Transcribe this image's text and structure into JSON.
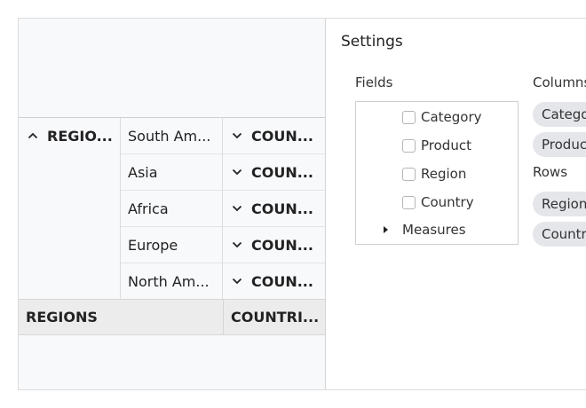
{
  "grid": {
    "row_header": "REGIO...",
    "rows": [
      {
        "region": "South Am...",
        "countries": "COUN..."
      },
      {
        "region": "Asia",
        "countries": "COUN..."
      },
      {
        "region": "Africa",
        "countries": "COUN..."
      },
      {
        "region": "Europe",
        "countries": "COUN..."
      },
      {
        "region": "North Am...",
        "countries": "COUN..."
      }
    ],
    "total": {
      "label": "REGIONS",
      "countries": "COUNTRI..."
    },
    "collapse_icon": "chevron-up-icon",
    "expand_icon": "chevron-down-icon"
  },
  "settings": {
    "title": "Settings",
    "fields_label": "Fields",
    "fields": [
      {
        "label": "Category",
        "checked": false
      },
      {
        "label": "Product",
        "checked": false
      },
      {
        "label": "Region",
        "checked": false
      },
      {
        "label": "Country",
        "checked": false
      }
    ],
    "measures_label": "Measures",
    "columns_label": "Columns",
    "columns": [
      "Category",
      "Product"
    ],
    "rows_label": "Rows",
    "rows": [
      "Region",
      "Country"
    ]
  },
  "colors": {
    "grid_bg": "#f8f9fb",
    "total_bg": "#ececec",
    "chip_bg": "#e4e6ea",
    "border": "#d6d6d6"
  }
}
